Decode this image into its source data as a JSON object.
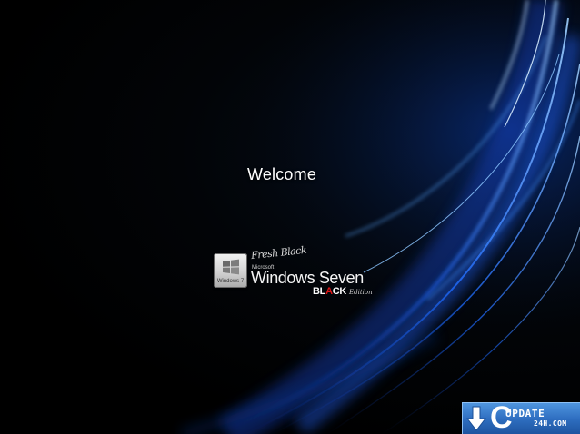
{
  "welcome": {
    "text": "Welcome"
  },
  "logo": {
    "badge_text": "Windows 7",
    "script_top": "Fresh Black",
    "microsoft": "Microsoft",
    "title": "Windows Seven",
    "black_prefix": "BL",
    "black_mid": "A",
    "black_suffix": "CK",
    "edition": "Edition"
  },
  "watermark": {
    "letter": "C",
    "top_text": "UPDATE",
    "bottom_text": "24H.COM"
  },
  "colors": {
    "background": "#000000",
    "swirl": "#1e6bff",
    "welcome_text": "#ffffff",
    "watermark_bg": "#2f6fc1",
    "logo_accent_red": "#e01515"
  },
  "icons": {
    "flag": "windows-flag-icon",
    "download": "download-arrow-icon"
  }
}
